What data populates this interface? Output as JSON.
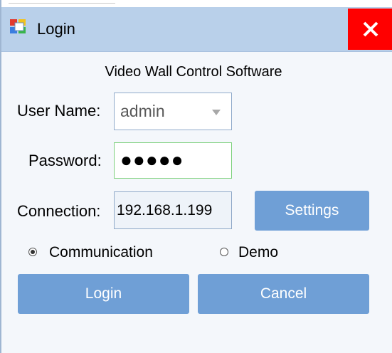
{
  "window": {
    "title": "Login",
    "app_icon": "video-wall-icon",
    "close_icon": "close-icon"
  },
  "subtitle": "Video Wall Control Software",
  "form": {
    "username_label": "User Name:",
    "username_value": "admin",
    "password_label": "Password:",
    "password_value": "●●●●●",
    "connection_label": "Connection:",
    "connection_value": "192.168.1.199",
    "settings_label": "Settings"
  },
  "mode": {
    "options": [
      {
        "label": "Communication",
        "selected": true
      },
      {
        "label": "Demo",
        "selected": false
      }
    ]
  },
  "actions": {
    "login_label": "Login",
    "cancel_label": "Cancel"
  },
  "colors": {
    "titlebar": "#b9d0ea",
    "close_button": "#ff0000",
    "button": "#6f9fd6",
    "password_border": "#7ed17e"
  }
}
